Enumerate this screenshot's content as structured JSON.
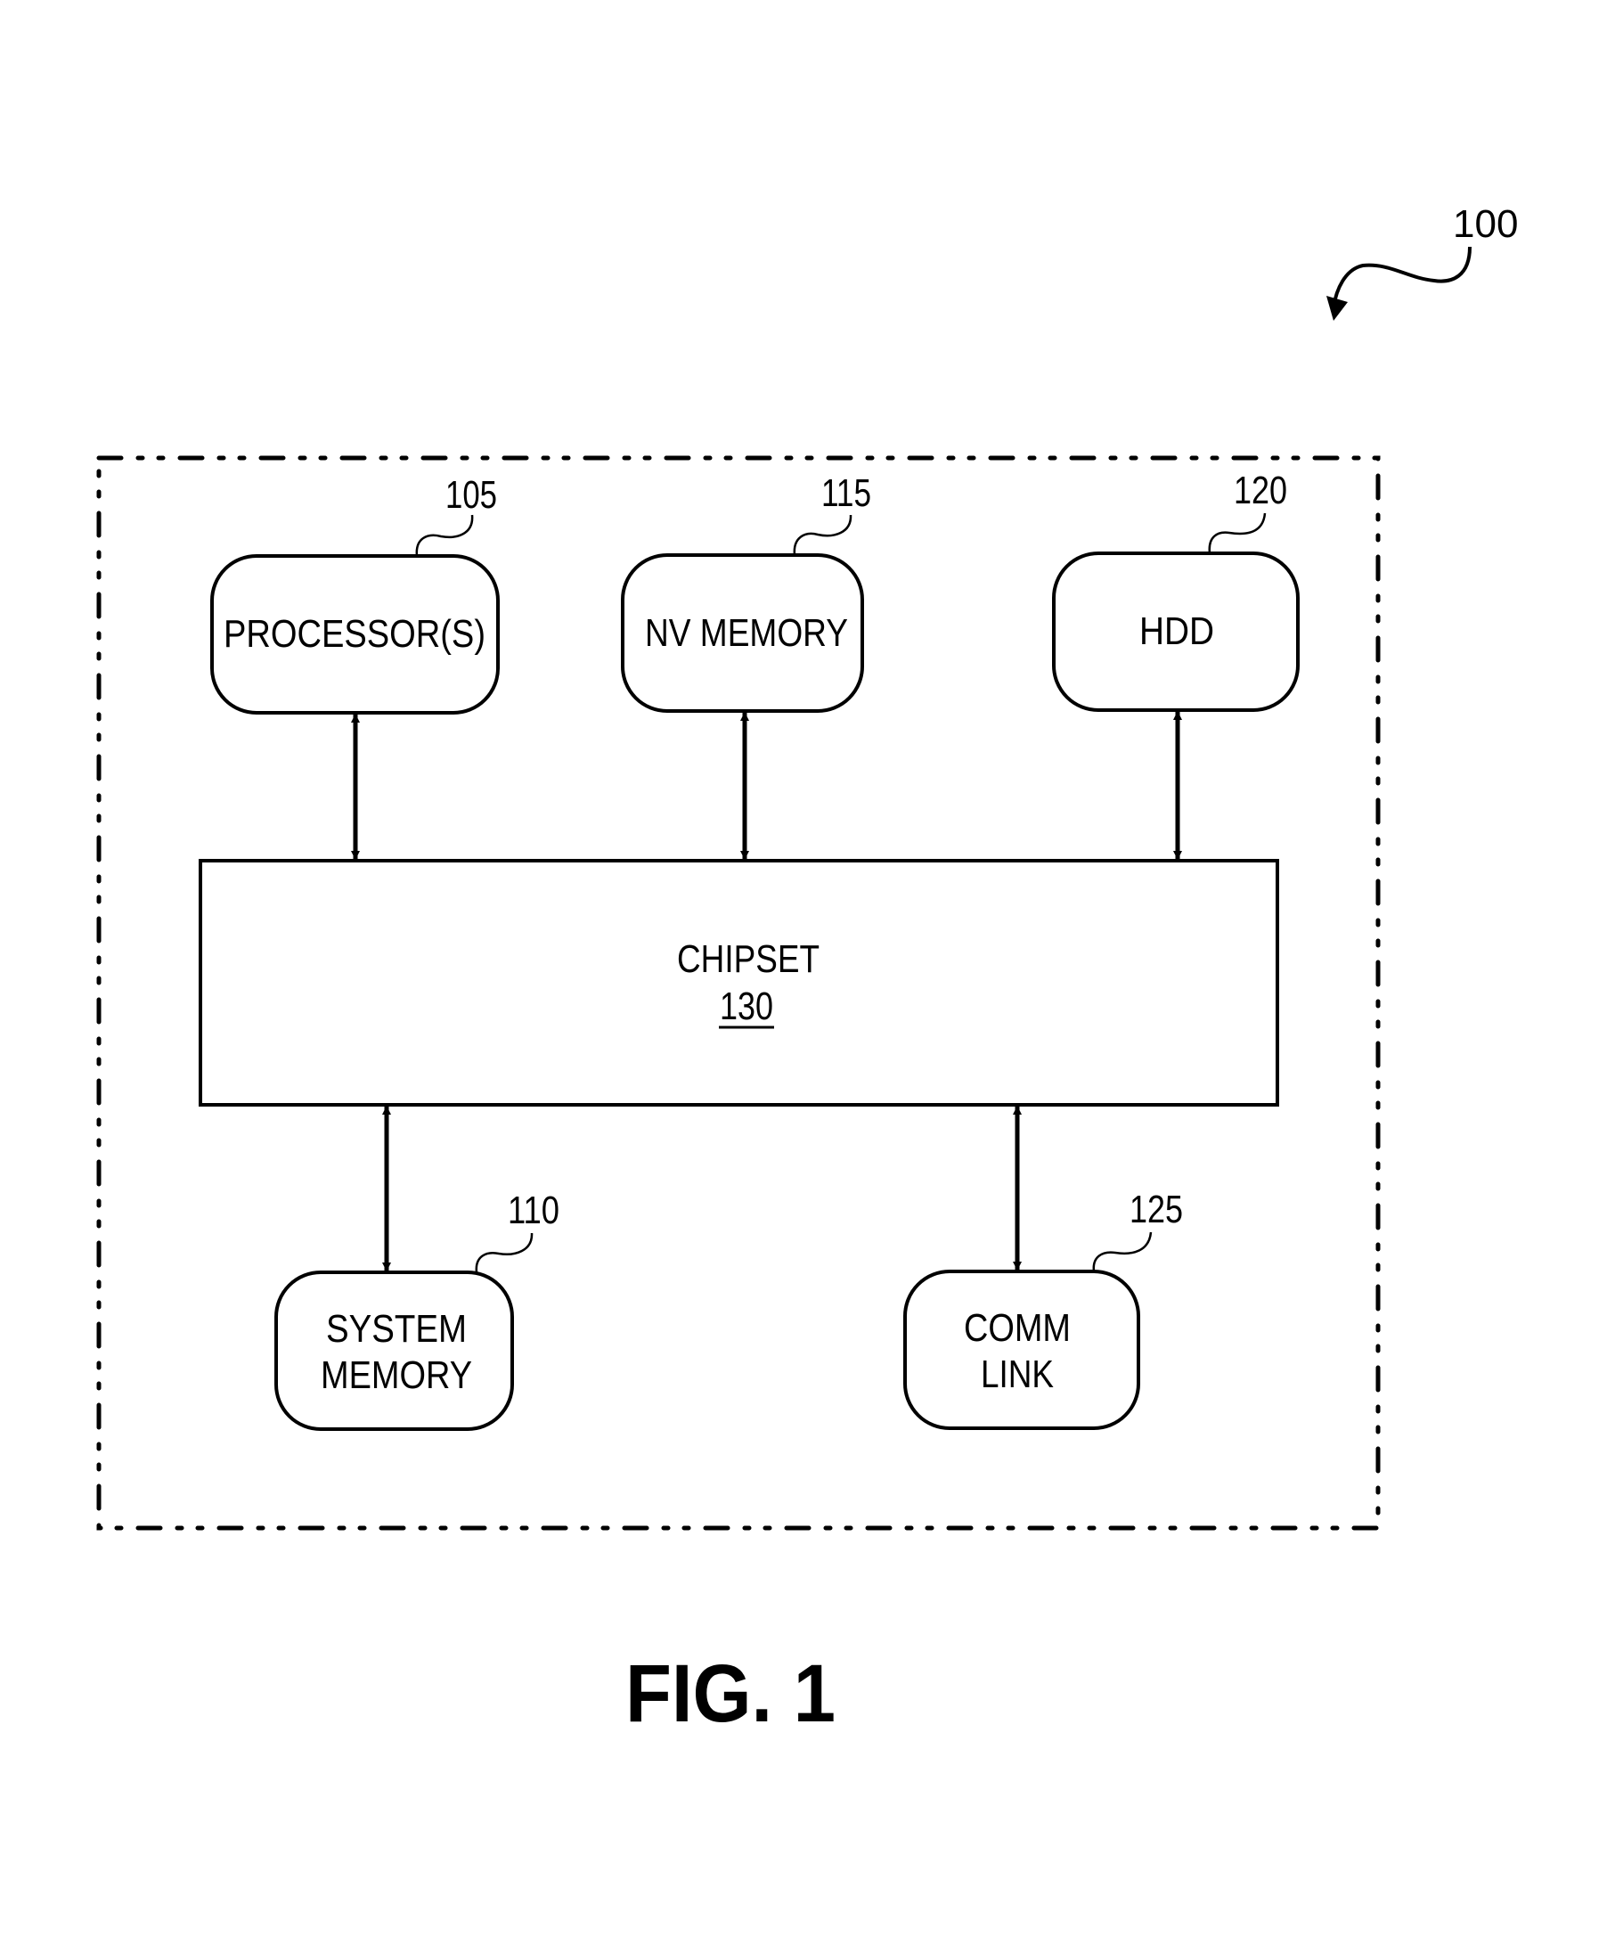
{
  "figure": {
    "caption": "FIG. 1",
    "reference": "100"
  },
  "components": {
    "processor": {
      "label": "PROCESSOR(S)",
      "ref": "105"
    },
    "nv_memory": {
      "label": "NV MEMORY",
      "ref": "115"
    },
    "hdd": {
      "label": "HDD",
      "ref": "120"
    },
    "chipset": {
      "label": "CHIPSET",
      "ref": "130"
    },
    "system_memory": {
      "label_line1": "SYSTEM",
      "label_line2": "MEMORY",
      "ref": "110"
    },
    "comm_link": {
      "label_line1": "COMM",
      "label_line2": "LINK",
      "ref": "125"
    }
  },
  "connections": [
    {
      "from": "processor",
      "to": "chipset",
      "direction": "bidirectional"
    },
    {
      "from": "nv_memory",
      "to": "chipset",
      "direction": "bidirectional"
    },
    {
      "from": "hdd",
      "to": "chipset",
      "direction": "bidirectional"
    },
    {
      "from": "chipset",
      "to": "system_memory",
      "direction": "bidirectional"
    },
    {
      "from": "chipset",
      "to": "comm_link",
      "direction": "bidirectional"
    }
  ],
  "colors": {
    "ink": "#000000",
    "background": "#ffffff"
  }
}
